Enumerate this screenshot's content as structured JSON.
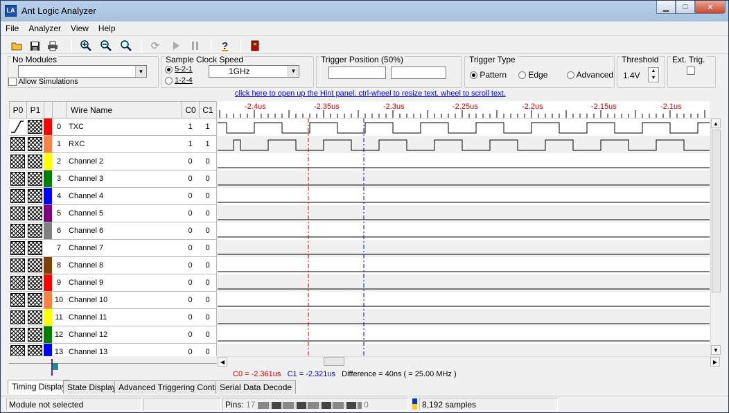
{
  "window": {
    "title": "Ant Logic Analyzer",
    "icon_text": "LA"
  },
  "window_buttons": {
    "minimize": "▁",
    "maximize": "□",
    "close": "✕"
  },
  "menu": [
    "File",
    "Analyzer",
    "View",
    "Help"
  ],
  "toolbar_icons": [
    "open-icon",
    "save-icon",
    "print-icon",
    "zoom-in-icon",
    "zoom-out-icon",
    "zoom-fit-icon",
    "refresh-icon",
    "play-icon",
    "pause-icon",
    "help-icon",
    "device-icon"
  ],
  "modules": {
    "label": "No Modules",
    "selected": "",
    "allow_sim": "Allow Simulations"
  },
  "sample_clock": {
    "label": "Sample Clock Speed",
    "opt1": "5-2-1",
    "opt2": "1-2-4",
    "speed": "1GHz"
  },
  "trigger_pos": {
    "label": "Trigger Position (50%)",
    "val1": "",
    "val2": ""
  },
  "trigger_type": {
    "label": "Trigger Type",
    "pattern": "Pattern",
    "edge": "Edge",
    "advanced": "Advanced"
  },
  "threshold": {
    "label": "Threshold",
    "value": "1.4V"
  },
  "ext_trig": {
    "label": "Ext. Trig."
  },
  "hint": "click here to open up the Hint panel. ctrl-wheel to resize text. wheel to scroll text.",
  "headers": {
    "p0": "P0",
    "p1": "P1",
    "wire": "Wire Name",
    "c0": "C0",
    "c1": "C1"
  },
  "ruler_labels": [
    "-2.4us",
    "-2.35us",
    "-2.3us",
    "-2.25us",
    "-2.2us",
    "-2.15us",
    "-2.1us"
  ],
  "channels": [
    {
      "num": "0",
      "name": "TXC",
      "color": "#ff0000",
      "c0": "1",
      "c1": "1"
    },
    {
      "num": "1",
      "name": "RXC",
      "color": "#ff8040",
      "c0": "1",
      "c1": "1"
    },
    {
      "num": "2",
      "name": "Channel 2",
      "color": "#ffff00",
      "c0": "0",
      "c1": "0"
    },
    {
      "num": "3",
      "name": "Channel 3",
      "color": "#008000",
      "c0": "0",
      "c1": "0"
    },
    {
      "num": "4",
      "name": "Channel 4",
      "color": "#0000ff",
      "c0": "0",
      "c1": "0"
    },
    {
      "num": "5",
      "name": "Channel 5",
      "color": "#800080",
      "c0": "0",
      "c1": "0"
    },
    {
      "num": "6",
      "name": "Channel 6",
      "color": "#808080",
      "c0": "0",
      "c1": "0"
    },
    {
      "num": "7",
      "name": "Channel 7",
      "color": "#ffffff",
      "c0": "0",
      "c1": "0"
    },
    {
      "num": "8",
      "name": "Channel 8",
      "color": "#804000",
      "c0": "0",
      "c1": "0"
    },
    {
      "num": "9",
      "name": "Channel 9",
      "color": "#ff0000",
      "c0": "0",
      "c1": "0"
    },
    {
      "num": "10",
      "name": "Channel 10",
      "color": "#ff8040",
      "c0": "0",
      "c1": "0"
    },
    {
      "num": "11",
      "name": "Channel 11",
      "color": "#ffff00",
      "c0": "0",
      "c1": "0"
    },
    {
      "num": "12",
      "name": "Channel 12",
      "color": "#008000",
      "c0": "0",
      "c1": "0"
    },
    {
      "num": "13",
      "name": "Channel 13",
      "color": "#0000ff",
      "c0": "0",
      "c1": "0"
    }
  ],
  "cursors": {
    "c0": "C0 = -2.361us",
    "c1": "C1 = -2.321us",
    "diff": "Difference = 40ns ( = 25.00 MHz )",
    "c0_color": "#cc0000",
    "c1_color": "#0000cc"
  },
  "tabs": [
    "Timing Display",
    "State Display",
    "Advanced Triggering Control",
    "Serial Data Decode"
  ],
  "status": {
    "module": "Module not selected",
    "pins_label": "Pins:",
    "pins_hi": "17",
    "pins_lo": "0",
    "samples": "8,192 samples"
  }
}
